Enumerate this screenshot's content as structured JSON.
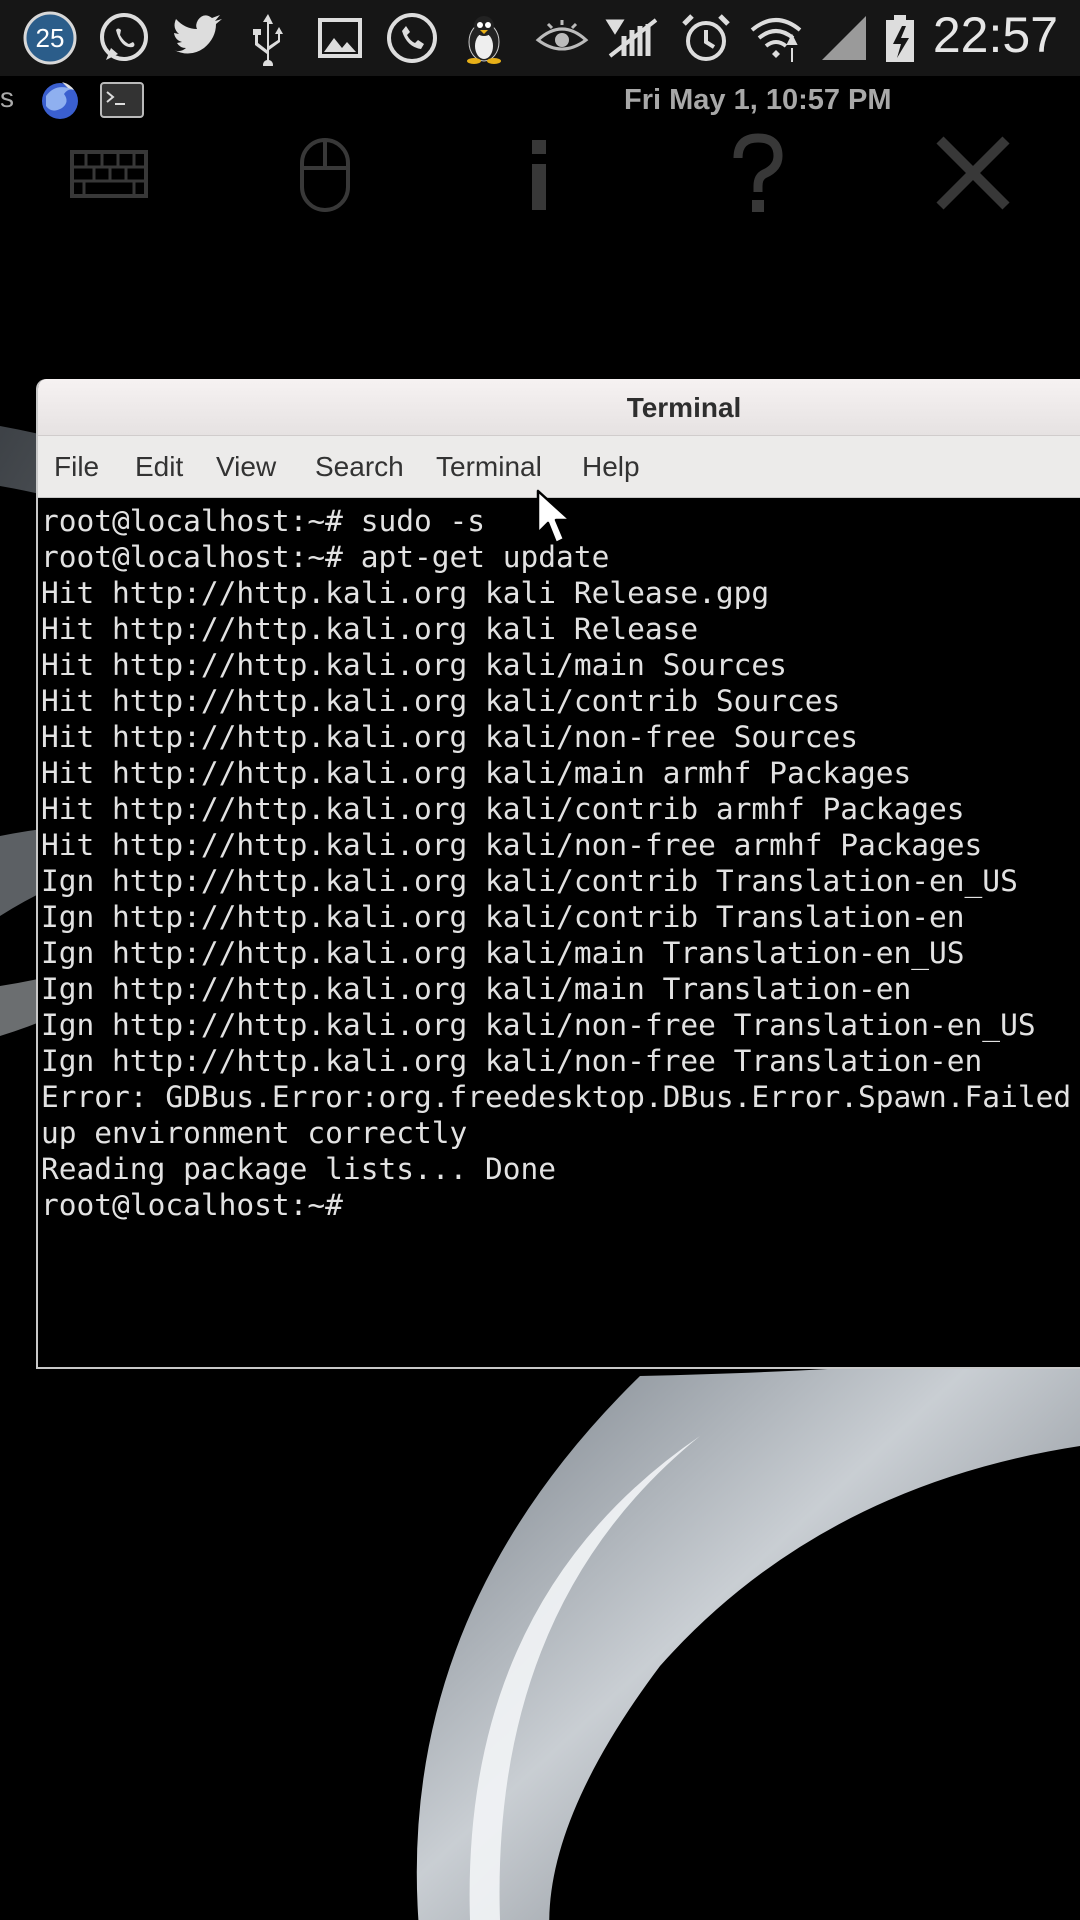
{
  "status_bar": {
    "notification_count": "25",
    "time": "22:57",
    "icons": [
      "notification-count-icon",
      "whatsapp-icon",
      "twitter-icon",
      "usb-icon",
      "gallery-icon",
      "phone-icon",
      "linux-penguin-icon",
      "eye-icon",
      "no-signal-icon",
      "alarm-icon",
      "wifi-icon",
      "signal-icon",
      "battery-icon"
    ]
  },
  "panel": {
    "edge_label": "s",
    "clock": "Fri May  1, 10:57 PM",
    "launchers": [
      "iceweasel-icon",
      "terminal-launcher-icon"
    ]
  },
  "vnc_toolbar": {
    "icons": [
      "keyboard-icon",
      "mouse-icon",
      "info-icon",
      "help-icon",
      "close-icon"
    ]
  },
  "window": {
    "title": "Terminal",
    "menu": [
      "File",
      "Edit",
      "View",
      "Search",
      "Terminal",
      "Help"
    ]
  },
  "terminal": {
    "lines": [
      "root@localhost:~# sudo -s",
      "root@localhost:~# apt-get update",
      "Hit http://http.kali.org kali Release.gpg",
      "Hit http://http.kali.org kali Release",
      "Hit http://http.kali.org kali/main Sources",
      "Hit http://http.kali.org kali/contrib Sources",
      "Hit http://http.kali.org kali/non-free Sources",
      "Hit http://http.kali.org kali/main armhf Packages",
      "Hit http://http.kali.org kali/contrib armhf Packages",
      "Hit http://http.kali.org kali/non-free armhf Packages",
      "Ign http://http.kali.org kali/contrib Translation-en_US",
      "Ign http://http.kali.org kali/contrib Translation-en",
      "Ign http://http.kali.org kali/main Translation-en_US",
      "Ign http://http.kali.org kali/main Translation-en",
      "Ign http://http.kali.org kali/non-free Translation-en_US",
      "Ign http://http.kali.org kali/non-free Translation-en",
      "Error: GDBus.Error:org.freedesktop.DBus.Error.Spawn.Failed",
      "up environment correctly",
      "Reading package lists... Done",
      "root@localhost:~# "
    ]
  }
}
